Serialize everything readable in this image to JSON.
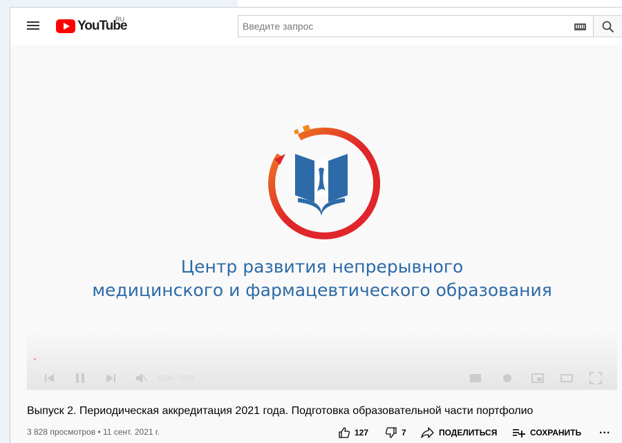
{
  "header": {
    "logo_text": "YouTube",
    "region": "RU",
    "search_placeholder": "Введите запрос"
  },
  "video": {
    "overlay_line1": "Центр развития непрерывного",
    "overlay_line2": "медицинского и фармацевтического образования",
    "time": "0:00 / 0:00",
    "title": "Выпуск 2. Периодическая аккредитация 2021 года. Подготовка образовательной части портфолио",
    "meta": "3 828 просмотров • 11 сент. 2021 г.",
    "likes": "127",
    "dislikes": "7",
    "share_label": "ПОДЕЛИТЬСЯ",
    "save_label": "СОХРАНИТЬ",
    "more_label": "..."
  },
  "colors": {
    "brand_blue": "#2d6aa8",
    "ring_red": "#e0262b",
    "ring_orange": "#f08a1e",
    "youtube_red": "#ff0000"
  }
}
